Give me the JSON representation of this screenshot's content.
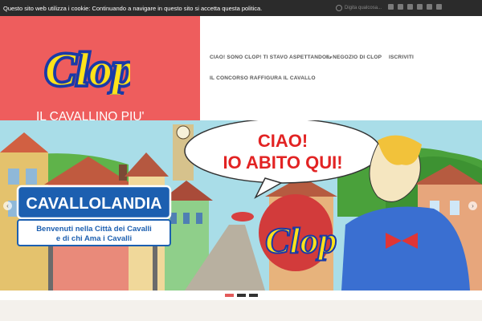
{
  "cookie": {
    "message": "Questo sito web utilizza i cookie: Continuando a navigare in questo sito si accetta questa politica.",
    "search_placeholder": "Digita qualcosa..."
  },
  "social_icons": [
    "facebook-icon",
    "twitter-icon",
    "instagram-icon",
    "youtube-icon",
    "rss-icon",
    "pinterest-icon"
  ],
  "brand": {
    "logo_text": "Clop",
    "tagline": "IL CAVALLINO PIU' SIMPATICO DEL MONDO!",
    "background": "#ee5d5d"
  },
  "nav": {
    "items": [
      {
        "label": "CIAO! SONO CLOP! TI STAVO ASPETTANDO!",
        "has_dropdown": true
      },
      {
        "label": "IL NEGOZIO DI CLOP"
      },
      {
        "label": "ISCRIVITI"
      },
      {
        "label": "IL CONCORSO RAFFIGURA IL CAVALLO"
      }
    ]
  },
  "hero": {
    "bubble_line1": "CIAO!",
    "bubble_line2": "IO ABITO QUI!",
    "sign_title": "CAVALLOLANDIA",
    "sign_sub1": "Benvenuti nella Città dei Cavalli",
    "sign_sub2": "e di chi Ama i Cavalli",
    "logo_text": "Clop",
    "prev_icon": "chevron-left-icon",
    "next_icon": "chevron-right-icon"
  },
  "slider": {
    "count": 3,
    "active_index": 0
  },
  "colors": {
    "accent": "#e35b5b",
    "topbar": "#2b2b2b"
  }
}
